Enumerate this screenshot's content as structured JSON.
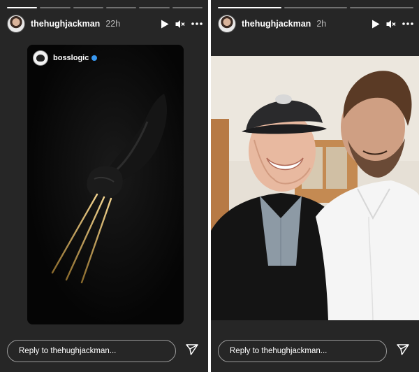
{
  "stories": [
    {
      "username": "thehughjackman",
      "time": "22h",
      "progress": [
        1.0,
        0.0,
        0.0,
        0.0,
        0.0,
        0.0
      ],
      "reply_placeholder": "Reply to thehughjackman...",
      "card": {
        "username": "bosslogic",
        "verified": true
      }
    },
    {
      "username": "thehughjackman",
      "time": "2h",
      "progress": [
        1.0,
        0.0,
        0.0
      ],
      "reply_placeholder": "Reply to thehughjackman..."
    }
  ],
  "icons": [
    "play-icon",
    "mute-icon",
    "more-icon",
    "send-icon",
    "verified-icon"
  ],
  "colors": {
    "background": "#262626",
    "verified": "#3897f0",
    "claw_gold": "#d9b36a"
  }
}
